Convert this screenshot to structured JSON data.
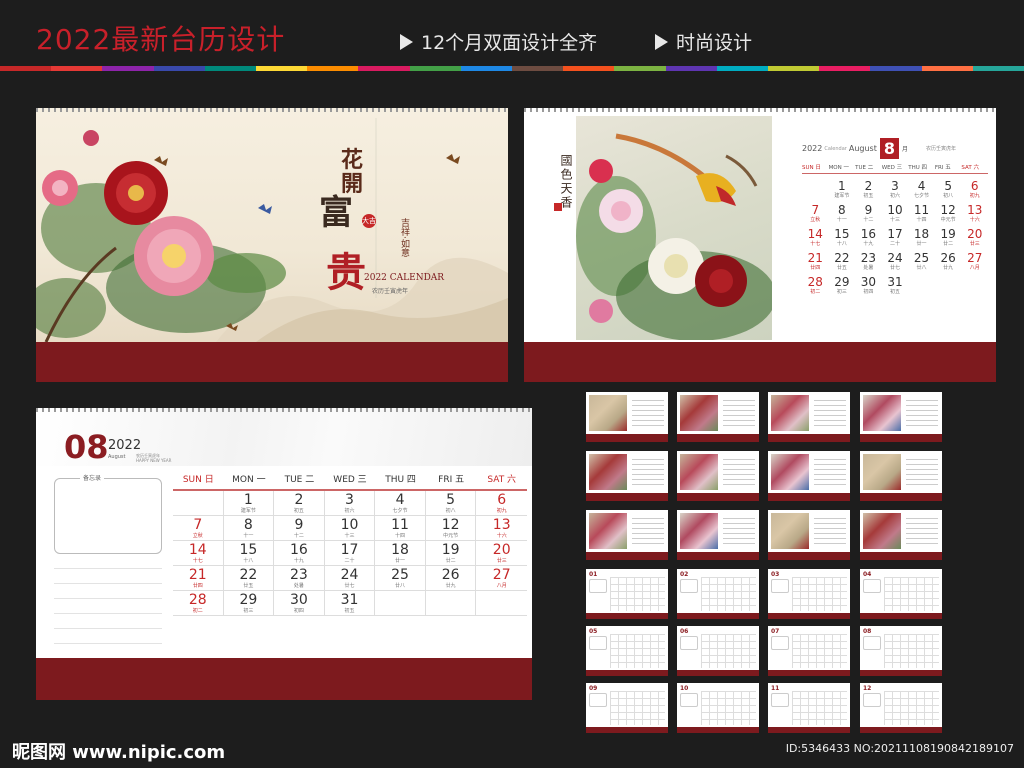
{
  "header": {
    "title": "2022最新台历设计",
    "features": [
      "12个月双面设计全齐",
      "时尚设计"
    ],
    "colors": [
      "#c62828",
      "#e53935",
      "#8e24aa",
      "#3949ab",
      "#00897b",
      "#fdd835",
      "#fb8c00",
      "#d81b60",
      "#43a047",
      "#1e88e5",
      "#6d4c41",
      "#f4511e",
      "#7cb342",
      "#5e35b1",
      "#00acc1",
      "#c0ca33",
      "#e91e63",
      "#3f51b5",
      "#ff7043",
      "#26a69a"
    ]
  },
  "cover": {
    "title_1": "花開",
    "title_2": "富",
    "title_3": "贵",
    "seal": "大吉",
    "motto": "吉祥·如意",
    "calendar_label": "2022 CALENDAR",
    "sub_label": "农历壬寅虎年"
  },
  "page_small": {
    "vertical_title": "國色天香",
    "year": "2022",
    "calendar_word": "Calendar",
    "month_en": "August",
    "month_num": "8",
    "month_unit": "月",
    "note": "农历壬寅虎年"
  },
  "page_large": {
    "month": "08",
    "year": "2022",
    "month_en": "August",
    "tiny_1": "农历壬寅虎年",
    "tiny_2": "HAPPY NEW YEAR",
    "memo_label": "备忘录"
  },
  "weekdays": [
    "SUN 日",
    "MON 一",
    "TUE 二",
    "WED 三",
    "THU 四",
    "FRI 五",
    "SAT 六"
  ],
  "days": [
    {
      "n": "",
      "l": ""
    },
    {
      "n": "1",
      "l": "建军节"
    },
    {
      "n": "2",
      "l": "初五"
    },
    {
      "n": "3",
      "l": "初六"
    },
    {
      "n": "4",
      "l": "七夕节"
    },
    {
      "n": "5",
      "l": "初八"
    },
    {
      "n": "6",
      "l": "初九",
      "red": true
    },
    {
      "n": "7",
      "l": "立秋",
      "red": true
    },
    {
      "n": "8",
      "l": "十一"
    },
    {
      "n": "9",
      "l": "十二"
    },
    {
      "n": "10",
      "l": "十三"
    },
    {
      "n": "11",
      "l": "十四"
    },
    {
      "n": "12",
      "l": "中元节"
    },
    {
      "n": "13",
      "l": "十六",
      "red": true
    },
    {
      "n": "14",
      "l": "十七",
      "red": true
    },
    {
      "n": "15",
      "l": "十八"
    },
    {
      "n": "16",
      "l": "十九"
    },
    {
      "n": "17",
      "l": "二十"
    },
    {
      "n": "18",
      "l": "廿一"
    },
    {
      "n": "19",
      "l": "廿二"
    },
    {
      "n": "20",
      "l": "廿三",
      "red": true
    },
    {
      "n": "21",
      "l": "廿四",
      "red": true
    },
    {
      "n": "22",
      "l": "廿五"
    },
    {
      "n": "23",
      "l": "处暑"
    },
    {
      "n": "24",
      "l": "廿七"
    },
    {
      "n": "25",
      "l": "廿八"
    },
    {
      "n": "26",
      "l": "廿九"
    },
    {
      "n": "27",
      "l": "八月",
      "red": true
    },
    {
      "n": "28",
      "l": "初二",
      "red": true
    },
    {
      "n": "29",
      "l": "初三"
    },
    {
      "n": "30",
      "l": "初四"
    },
    {
      "n": "31",
      "l": "初五"
    },
    {
      "n": "",
      "l": ""
    },
    {
      "n": "",
      "l": ""
    },
    {
      "n": "",
      "l": ""
    }
  ],
  "month_thumbs": [
    "01",
    "02",
    "03",
    "04",
    "05",
    "06",
    "07",
    "08",
    "09",
    "10",
    "11",
    "12"
  ],
  "footer": {
    "logo": "昵图网 www.nipic.com",
    "id": "ID:5346433 NO:20211108190842189107"
  }
}
